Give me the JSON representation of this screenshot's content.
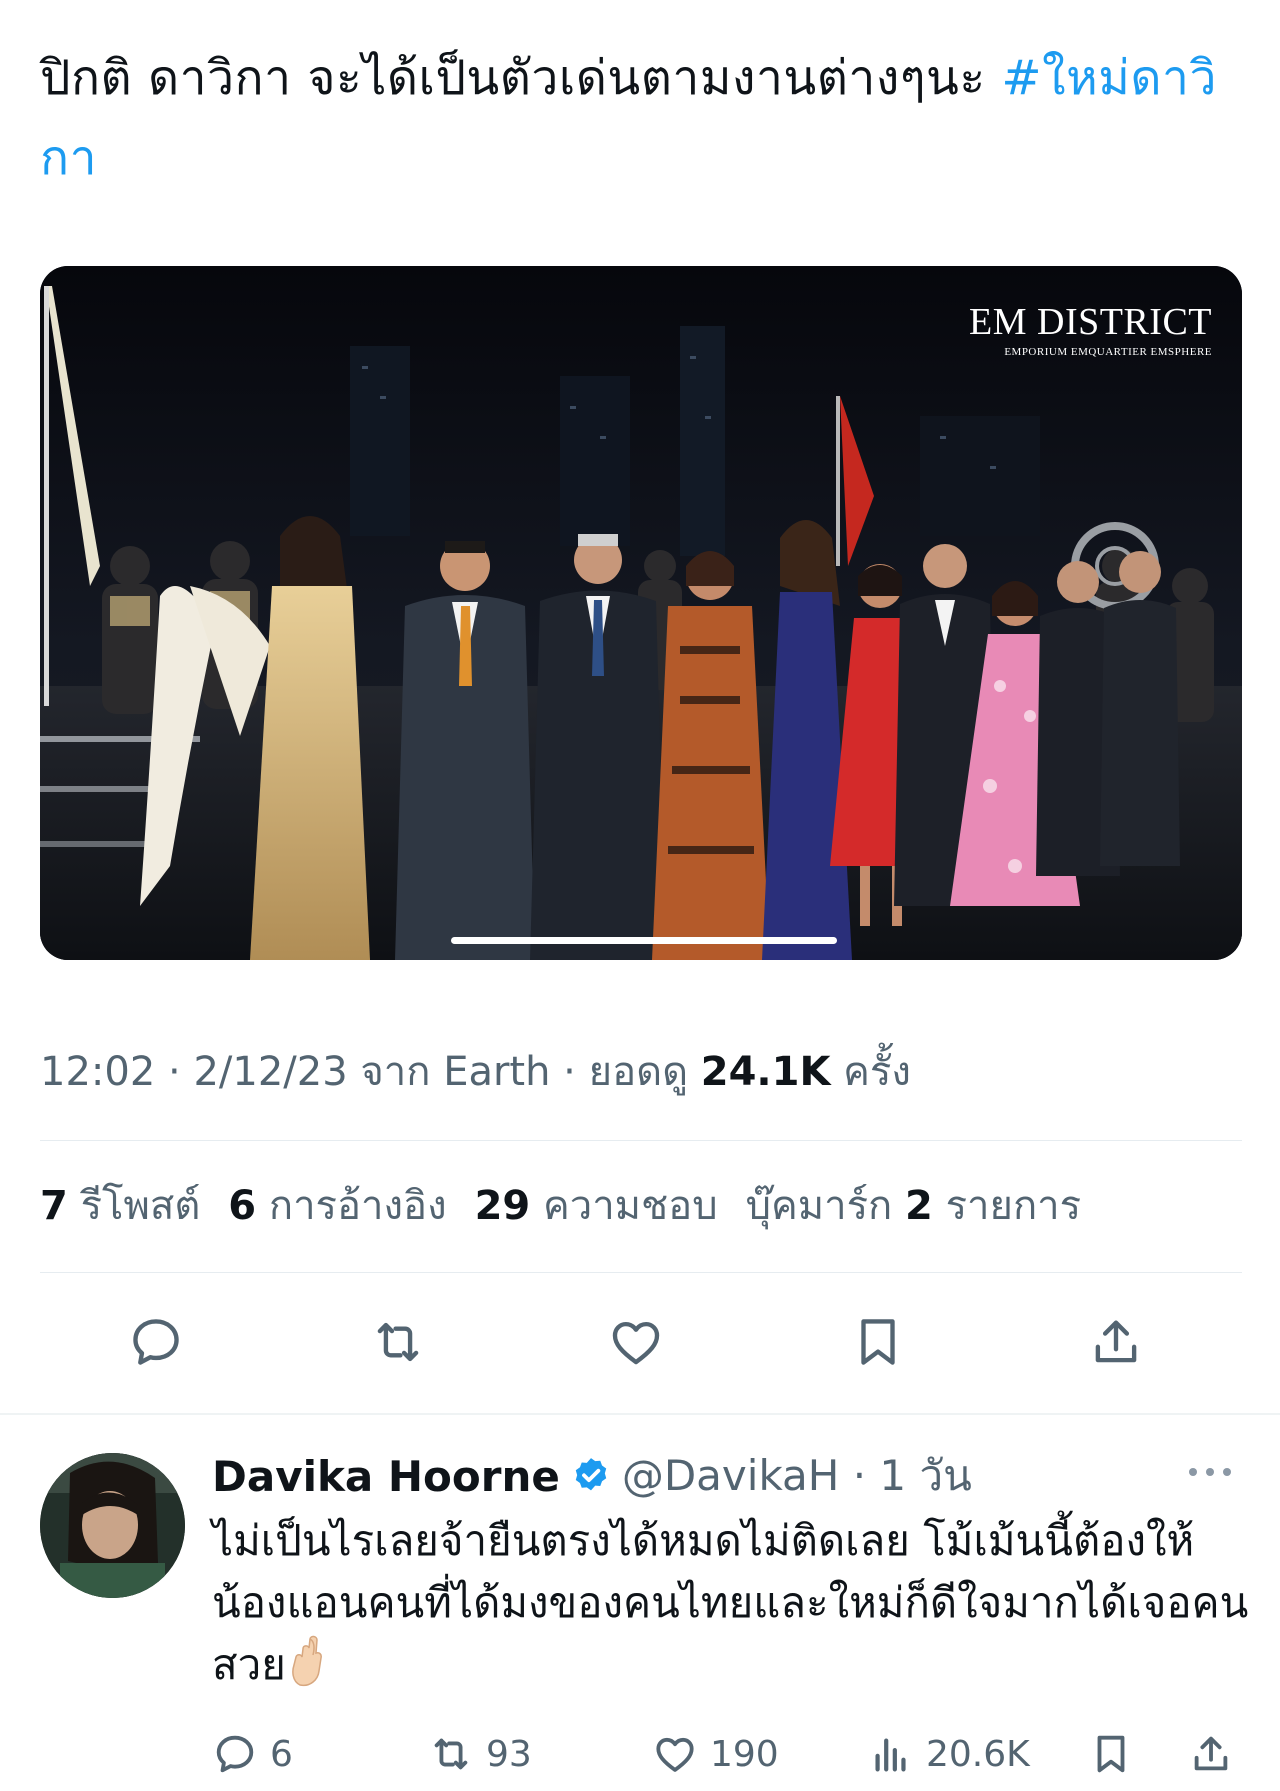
{
  "tweet": {
    "text": "ปิกติ ดาวิกา จะได้เป็นตัวเด่นตามงานต่างๆนะ ",
    "hashtag": "#ใหม่ดาวิกา",
    "media": {
      "watermark_title": "EM DISTRICT",
      "watermark_subtitle": "EMPORIUM EMQUARTIER EMSPHERE"
    },
    "meta": {
      "time": "12:02",
      "date": "2/12/23",
      "source_prefix": "จาก",
      "source": "Earth",
      "views_prefix": "ยอดดู",
      "views_count": "24.1K",
      "views_suffix": "ครั้ง"
    },
    "stats": {
      "reposts_count": "7",
      "reposts_label": "รีโพสต์",
      "quotes_count": "6",
      "quotes_label": "การอ้างอิง",
      "likes_count": "29",
      "likes_label": "ความชอบ",
      "bookmarks_label": "บุ๊คมาร์ก",
      "bookmarks_count": "2",
      "bookmarks_suffix": "รายการ"
    },
    "actions": [
      "reply-icon",
      "repost-icon",
      "like-icon",
      "bookmark-icon",
      "share-icon"
    ]
  },
  "reply": {
    "name": "Davika Hoorne",
    "handle": "@DavikaH",
    "time": "1 วัน",
    "text": "ไม่เป็นไรเลยจ้ายืนตรงได้หมดไม่ติดเลย โม้เม้นนี้ต้องให้น้องแอนคนที่ได้มงของคนไทยและใหม่ก็ดีใจมากได้เจอคนสวย",
    "emoji": "crossed-fingers-emoji",
    "stats": {
      "replies": "6",
      "reposts": "93",
      "likes": "190",
      "views": "20.6K"
    }
  },
  "colors": {
    "link": "#1d9bf0",
    "secondary_text": "#536471",
    "primary_text": "#0f1419",
    "divider": "#e6ecf0"
  }
}
